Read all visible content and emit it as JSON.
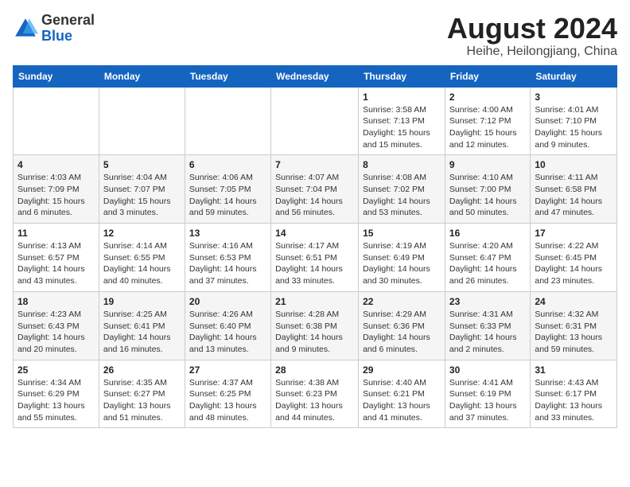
{
  "logo": {
    "general": "General",
    "blue": "Blue"
  },
  "title": "August 2024",
  "location": "Heihe, Heilongjiang, China",
  "weekdays": [
    "Sunday",
    "Monday",
    "Tuesday",
    "Wednesday",
    "Thursday",
    "Friday",
    "Saturday"
  ],
  "weeks": [
    [
      {
        "day": "",
        "info": ""
      },
      {
        "day": "",
        "info": ""
      },
      {
        "day": "",
        "info": ""
      },
      {
        "day": "",
        "info": ""
      },
      {
        "day": "1",
        "info": "Sunrise: 3:58 AM\nSunset: 7:13 PM\nDaylight: 15 hours\nand 15 minutes."
      },
      {
        "day": "2",
        "info": "Sunrise: 4:00 AM\nSunset: 7:12 PM\nDaylight: 15 hours\nand 12 minutes."
      },
      {
        "day": "3",
        "info": "Sunrise: 4:01 AM\nSunset: 7:10 PM\nDaylight: 15 hours\nand 9 minutes."
      }
    ],
    [
      {
        "day": "4",
        "info": "Sunrise: 4:03 AM\nSunset: 7:09 PM\nDaylight: 15 hours\nand 6 minutes."
      },
      {
        "day": "5",
        "info": "Sunrise: 4:04 AM\nSunset: 7:07 PM\nDaylight: 15 hours\nand 3 minutes."
      },
      {
        "day": "6",
        "info": "Sunrise: 4:06 AM\nSunset: 7:05 PM\nDaylight: 14 hours\nand 59 minutes."
      },
      {
        "day": "7",
        "info": "Sunrise: 4:07 AM\nSunset: 7:04 PM\nDaylight: 14 hours\nand 56 minutes."
      },
      {
        "day": "8",
        "info": "Sunrise: 4:08 AM\nSunset: 7:02 PM\nDaylight: 14 hours\nand 53 minutes."
      },
      {
        "day": "9",
        "info": "Sunrise: 4:10 AM\nSunset: 7:00 PM\nDaylight: 14 hours\nand 50 minutes."
      },
      {
        "day": "10",
        "info": "Sunrise: 4:11 AM\nSunset: 6:58 PM\nDaylight: 14 hours\nand 47 minutes."
      }
    ],
    [
      {
        "day": "11",
        "info": "Sunrise: 4:13 AM\nSunset: 6:57 PM\nDaylight: 14 hours\nand 43 minutes."
      },
      {
        "day": "12",
        "info": "Sunrise: 4:14 AM\nSunset: 6:55 PM\nDaylight: 14 hours\nand 40 minutes."
      },
      {
        "day": "13",
        "info": "Sunrise: 4:16 AM\nSunset: 6:53 PM\nDaylight: 14 hours\nand 37 minutes."
      },
      {
        "day": "14",
        "info": "Sunrise: 4:17 AM\nSunset: 6:51 PM\nDaylight: 14 hours\nand 33 minutes."
      },
      {
        "day": "15",
        "info": "Sunrise: 4:19 AM\nSunset: 6:49 PM\nDaylight: 14 hours\nand 30 minutes."
      },
      {
        "day": "16",
        "info": "Sunrise: 4:20 AM\nSunset: 6:47 PM\nDaylight: 14 hours\nand 26 minutes."
      },
      {
        "day": "17",
        "info": "Sunrise: 4:22 AM\nSunset: 6:45 PM\nDaylight: 14 hours\nand 23 minutes."
      }
    ],
    [
      {
        "day": "18",
        "info": "Sunrise: 4:23 AM\nSunset: 6:43 PM\nDaylight: 14 hours\nand 20 minutes."
      },
      {
        "day": "19",
        "info": "Sunrise: 4:25 AM\nSunset: 6:41 PM\nDaylight: 14 hours\nand 16 minutes."
      },
      {
        "day": "20",
        "info": "Sunrise: 4:26 AM\nSunset: 6:40 PM\nDaylight: 14 hours\nand 13 minutes."
      },
      {
        "day": "21",
        "info": "Sunrise: 4:28 AM\nSunset: 6:38 PM\nDaylight: 14 hours\nand 9 minutes."
      },
      {
        "day": "22",
        "info": "Sunrise: 4:29 AM\nSunset: 6:36 PM\nDaylight: 14 hours\nand 6 minutes."
      },
      {
        "day": "23",
        "info": "Sunrise: 4:31 AM\nSunset: 6:33 PM\nDaylight: 14 hours\nand 2 minutes."
      },
      {
        "day": "24",
        "info": "Sunrise: 4:32 AM\nSunset: 6:31 PM\nDaylight: 13 hours\nand 59 minutes."
      }
    ],
    [
      {
        "day": "25",
        "info": "Sunrise: 4:34 AM\nSunset: 6:29 PM\nDaylight: 13 hours\nand 55 minutes."
      },
      {
        "day": "26",
        "info": "Sunrise: 4:35 AM\nSunset: 6:27 PM\nDaylight: 13 hours\nand 51 minutes."
      },
      {
        "day": "27",
        "info": "Sunrise: 4:37 AM\nSunset: 6:25 PM\nDaylight: 13 hours\nand 48 minutes."
      },
      {
        "day": "28",
        "info": "Sunrise: 4:38 AM\nSunset: 6:23 PM\nDaylight: 13 hours\nand 44 minutes."
      },
      {
        "day": "29",
        "info": "Sunrise: 4:40 AM\nSunset: 6:21 PM\nDaylight: 13 hours\nand 41 minutes."
      },
      {
        "day": "30",
        "info": "Sunrise: 4:41 AM\nSunset: 6:19 PM\nDaylight: 13 hours\nand 37 minutes."
      },
      {
        "day": "31",
        "info": "Sunrise: 4:43 AM\nSunset: 6:17 PM\nDaylight: 13 hours\nand 33 minutes."
      }
    ]
  ]
}
